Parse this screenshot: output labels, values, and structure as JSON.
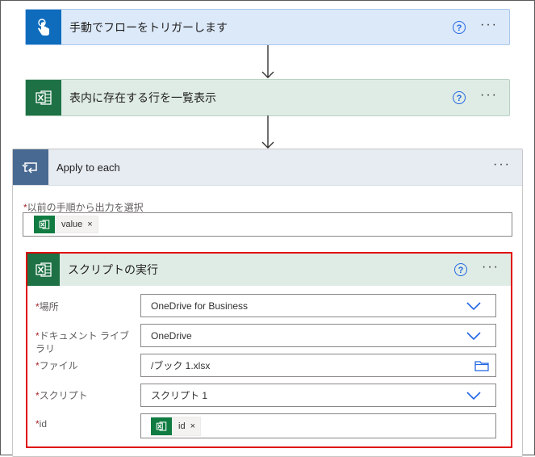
{
  "trigger": {
    "title": "手動でフローをトリガーします",
    "help": "?",
    "more": "···"
  },
  "list_rows": {
    "title": "表内に存在する行を一覧表示",
    "help": "?",
    "more": "···"
  },
  "apply_each": {
    "title": "Apply to each",
    "more": "···",
    "select_output_label": "以前の手順から出力を選択",
    "token": {
      "label": "value",
      "remove": "×"
    }
  },
  "run_script": {
    "title": "スクリプトの実行",
    "help": "?",
    "more": "···",
    "fields": {
      "location": {
        "label": "場所",
        "value": "OneDrive for Business"
      },
      "library": {
        "label_line1": "ドキュメント ライブ",
        "label_line2": "ラリ",
        "value": "OneDrive"
      },
      "file": {
        "label": "ファイル",
        "value": "/ブック 1.xlsx"
      },
      "script": {
        "label": "スクリプト",
        "value": "スクリプト 1"
      },
      "id": {
        "label": "id",
        "token_label": "id",
        "token_remove": "×"
      }
    }
  },
  "colors": {
    "trigger_tile": "#0f6cbd",
    "trigger_bg": "#dce9f9",
    "excel_tile": "#1e7145",
    "excel_bg": "#dfece5",
    "loop_tile": "#486991",
    "loop_bg": "#e7ebf2",
    "highlight": "#e00000",
    "link_blue": "#2266e3"
  }
}
